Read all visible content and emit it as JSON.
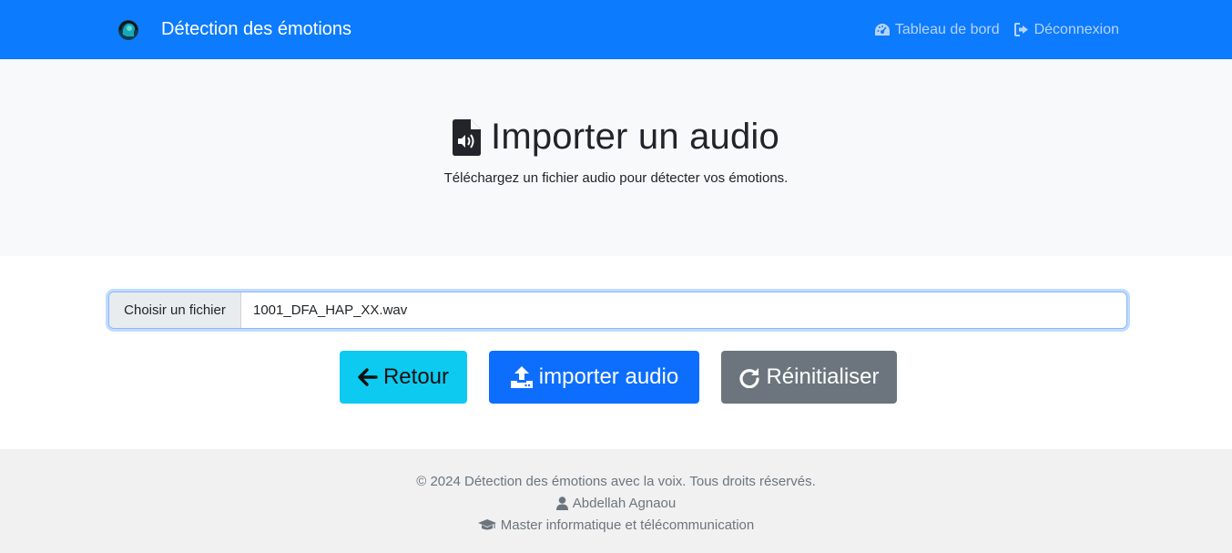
{
  "navbar": {
    "brand": "Détection des émotions",
    "links": [
      {
        "label": "Tableau de bord",
        "icon": "dashboard-icon"
      },
      {
        "label": "Déconnexion",
        "icon": "sign-out-icon"
      }
    ]
  },
  "hero": {
    "title": "Importer un audio",
    "subtitle": "Téléchargez un fichier audio pour détecter vos émotions.",
    "icon": "file-audio-icon"
  },
  "upload": {
    "choose_label": "Choisir un fichier",
    "file_name": "1001_DFA_HAP_XX.wav"
  },
  "buttons": {
    "back": "Retour",
    "import": "importer audio",
    "reset": "Réinitialiser"
  },
  "footer": {
    "copyright": "© 2024 Détection des émotions avec la voix. Tous droits réservés.",
    "author": "Abdellah Agnaou",
    "program": "Master informatique et télécommunication"
  },
  "colors": {
    "navbar": "#0d7bfd",
    "btn_back": "#0dcaf0",
    "btn_import": "#0d6efd",
    "btn_reset": "#6c757d"
  }
}
